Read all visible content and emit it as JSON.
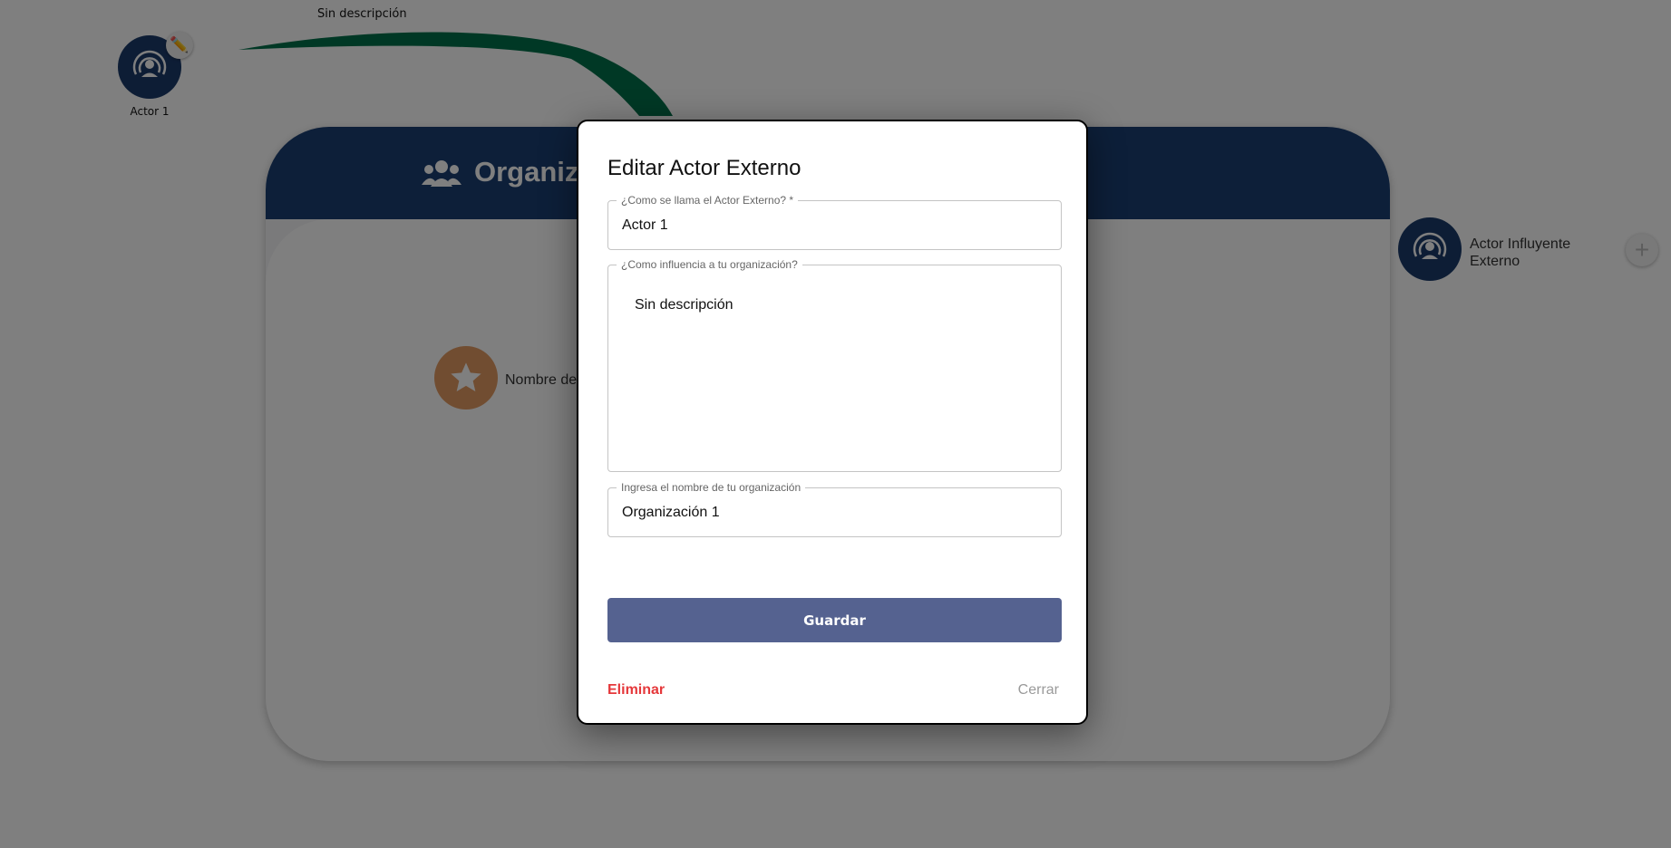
{
  "canvas": {
    "actor_node": {
      "label": "Actor 1",
      "icon": "broadcast-person-icon",
      "edit_icon": "pencil-icon"
    },
    "edge_label": "Sin descripción",
    "edge_color": "#00704a",
    "org_card": {
      "title": "Organiz",
      "header_icon": "users-icon",
      "header_color": "#1b3f73",
      "star_node": {
        "icon": "star-icon",
        "label": "Nombre de",
        "color": "#e39a62"
      }
    },
    "influencer_node": {
      "icon": "broadcast-person-icon",
      "label": "Actor Influyente Externo"
    },
    "add_button_icon": "plus-icon"
  },
  "modal": {
    "title": "Editar Actor Externo",
    "fields": {
      "name": {
        "label": "¿Como se llama el Actor Externo? *",
        "value": "Actor 1"
      },
      "influence": {
        "label": "¿Como influencia a tu organización?",
        "value": "Sin descripción"
      },
      "organization": {
        "label": "Ingresa el nombre de tu organización",
        "value": "Organización 1"
      }
    },
    "save_label": "Guardar",
    "delete_label": "Eliminar",
    "close_label": "Cerrar",
    "colors": {
      "save": "#556290",
      "delete": "#e5383b"
    }
  }
}
